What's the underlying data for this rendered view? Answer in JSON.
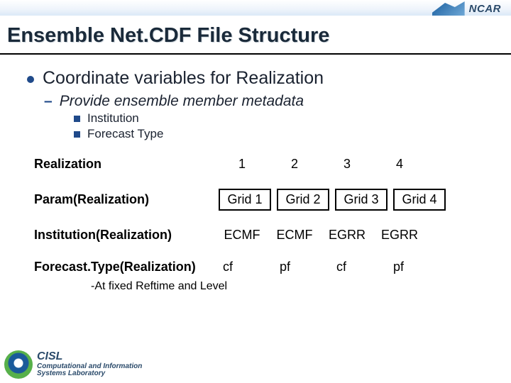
{
  "logo": {
    "ncar": "NCAR",
    "cisl_big": "CISL",
    "cisl_line1": "Computational and Information",
    "cisl_line2": "Systems Laboratory"
  },
  "title": "Ensemble Net.CDF File Structure",
  "bullets": {
    "l1": "Coordinate variables for Realization",
    "l2": "Provide ensemble member metadata",
    "l3a": "Institution",
    "l3b": "Forecast Type"
  },
  "table": {
    "headers": [
      "1",
      "2",
      "3",
      "4"
    ],
    "rows": [
      {
        "label": "Realization",
        "style": "plain",
        "cells": [
          "1",
          "2",
          "3",
          "4"
        ]
      },
      {
        "label": "Param(Realization)",
        "style": "boxed",
        "cells": [
          "Grid 1",
          "Grid 2",
          "Grid 3",
          "Grid 4"
        ]
      },
      {
        "label": "Institution(Realization)",
        "style": "plain",
        "cells": [
          "ECMF",
          "ECMF",
          "EGRR",
          "EGRR"
        ]
      },
      {
        "label": "Forecast.Type(Realization)",
        "style": "plain",
        "cells": [
          "cf",
          "pf",
          "cf",
          "pf"
        ]
      }
    ]
  },
  "footnote": "-At fixed Reftime and Level"
}
